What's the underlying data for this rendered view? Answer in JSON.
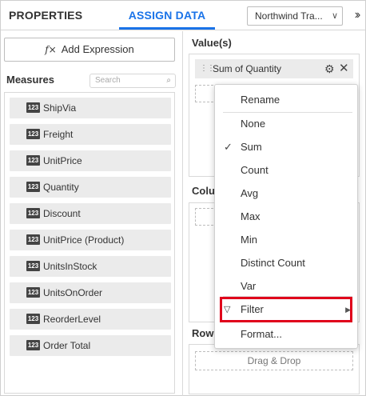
{
  "tabs": {
    "properties": "PROPERTIES",
    "assign_data": "ASSIGN DATA"
  },
  "datasource": {
    "selected": "Northwind Tra..."
  },
  "icons": {
    "collapse": "double-chevron-right-icon",
    "fx": "function-icon",
    "search": "magnifier-icon",
    "numeric": "123",
    "grip": "drag-handle-icon",
    "gear": "gear-icon",
    "close": "close-icon",
    "check": "checkmark-icon",
    "filter": "funnel-icon",
    "submenu": "triangle-right-icon"
  },
  "left": {
    "add_expression": "Add Expression",
    "fx_glyph": "f×",
    "measures_label": "Measures",
    "search_placeholder": "Search",
    "measures": [
      "ShipVia",
      "Freight",
      "UnitPrice",
      "Quantity",
      "Discount",
      "UnitPrice (Product)",
      "UnitsInStock",
      "UnitsOnOrder",
      "ReorderLevel",
      "Order Total"
    ]
  },
  "right": {
    "values_label": "Value(s)",
    "value_item": "Sum of Quantity",
    "columns_label": "Colu",
    "rows_label": "Row",
    "drag_drop": "Drag & Drop"
  },
  "menu": {
    "rename": "Rename",
    "aggregations": [
      "None",
      "Sum",
      "Count",
      "Avg",
      "Max",
      "Min",
      "Distinct Count",
      "Var"
    ],
    "checked": "Sum",
    "filter": "Filter",
    "format": "Format..."
  },
  "colors": {
    "accent": "#1a73e8",
    "highlight": "#e0001b",
    "item_bg": "#ebebeb"
  }
}
